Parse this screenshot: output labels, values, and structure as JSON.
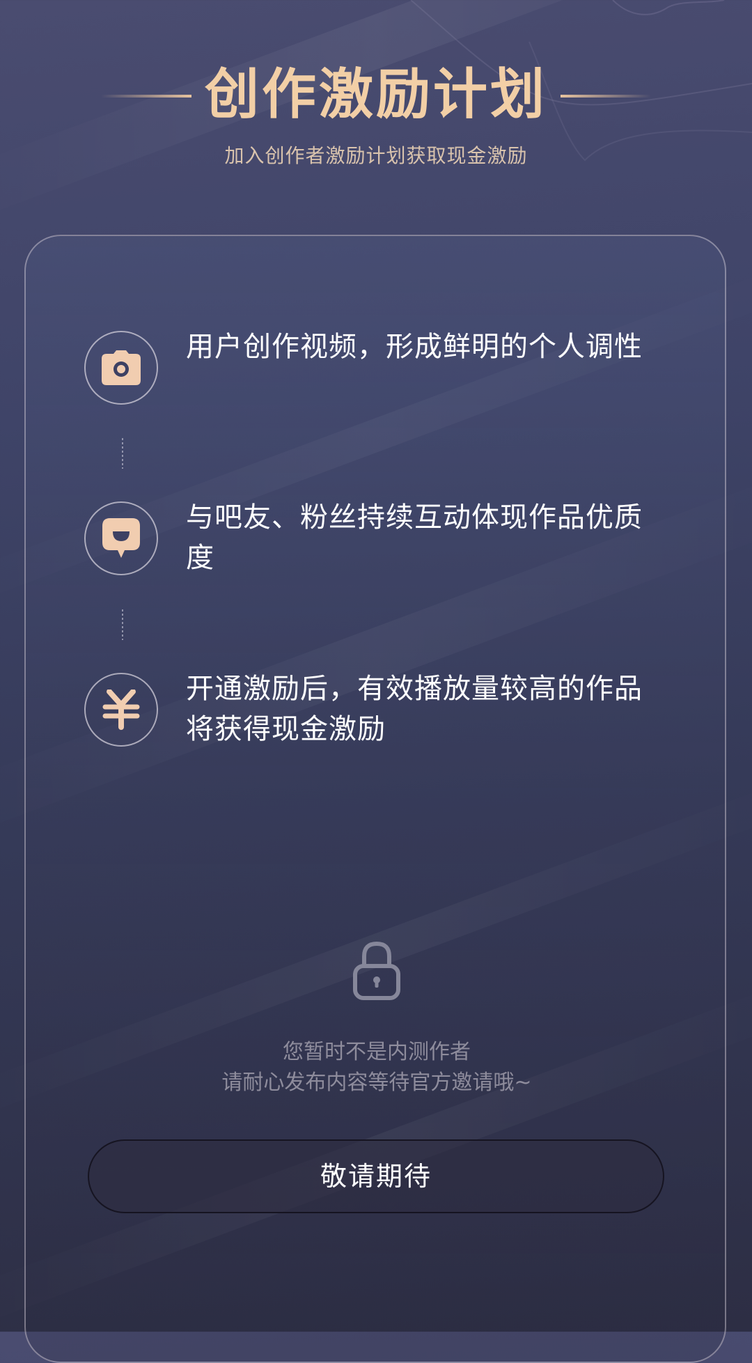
{
  "header": {
    "title": "创作激励计划",
    "subtitle": "加入创作者激励计划获取现金激励"
  },
  "features": [
    {
      "icon": "camera-icon",
      "text": "用户创作视频，形成鲜明的个人调性"
    },
    {
      "icon": "chat-bubble-icon",
      "text": "与吧友、粉丝持续互动体现作品优质度"
    },
    {
      "icon": "yen-icon",
      "text": "开通激励后，有效播放量较高的作品将获得现金激励"
    }
  ],
  "status": {
    "icon": "lock-icon",
    "line1": "您暂时不是内测作者",
    "line2": "请耐心发布内容等待官方邀请哦~"
  },
  "action": {
    "button_label": "敬请期待"
  },
  "colors": {
    "accent_gold": "#f2cfa6",
    "icon_fill": "#f1cdb0",
    "muted_text": "#8e8c9c"
  }
}
